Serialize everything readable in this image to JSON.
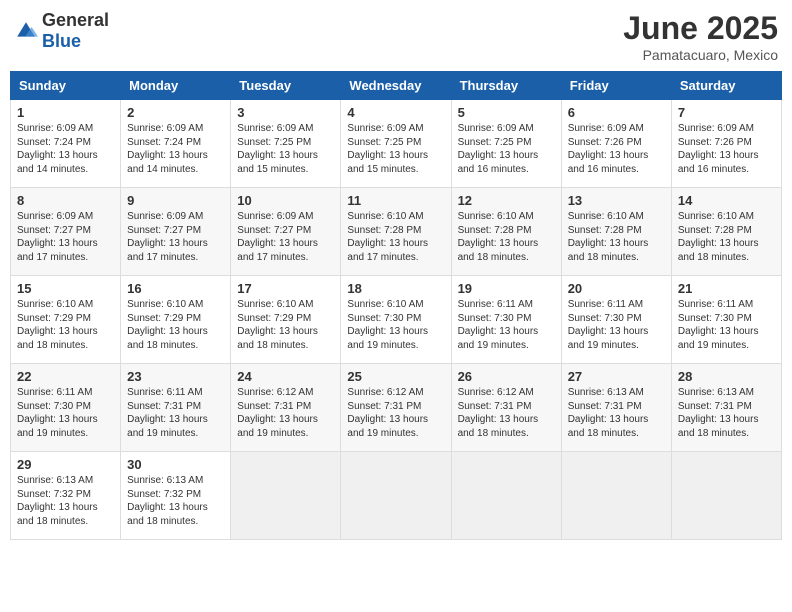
{
  "logo": {
    "general": "General",
    "blue": "Blue"
  },
  "header": {
    "month": "June 2025",
    "location": "Pamatacuaro, Mexico"
  },
  "weekdays": [
    "Sunday",
    "Monday",
    "Tuesday",
    "Wednesday",
    "Thursday",
    "Friday",
    "Saturday"
  ],
  "weeks": [
    [
      {
        "day": 1,
        "sunrise": "6:09 AM",
        "sunset": "7:24 PM",
        "daylight": "13 hours and 14 minutes."
      },
      {
        "day": 2,
        "sunrise": "6:09 AM",
        "sunset": "7:24 PM",
        "daylight": "13 hours and 14 minutes."
      },
      {
        "day": 3,
        "sunrise": "6:09 AM",
        "sunset": "7:25 PM",
        "daylight": "13 hours and 15 minutes."
      },
      {
        "day": 4,
        "sunrise": "6:09 AM",
        "sunset": "7:25 PM",
        "daylight": "13 hours and 15 minutes."
      },
      {
        "day": 5,
        "sunrise": "6:09 AM",
        "sunset": "7:25 PM",
        "daylight": "13 hours and 16 minutes."
      },
      {
        "day": 6,
        "sunrise": "6:09 AM",
        "sunset": "7:26 PM",
        "daylight": "13 hours and 16 minutes."
      },
      {
        "day": 7,
        "sunrise": "6:09 AM",
        "sunset": "7:26 PM",
        "daylight": "13 hours and 16 minutes."
      }
    ],
    [
      {
        "day": 8,
        "sunrise": "6:09 AM",
        "sunset": "7:27 PM",
        "daylight": "13 hours and 17 minutes."
      },
      {
        "day": 9,
        "sunrise": "6:09 AM",
        "sunset": "7:27 PM",
        "daylight": "13 hours and 17 minutes."
      },
      {
        "day": 10,
        "sunrise": "6:09 AM",
        "sunset": "7:27 PM",
        "daylight": "13 hours and 17 minutes."
      },
      {
        "day": 11,
        "sunrise": "6:10 AM",
        "sunset": "7:28 PM",
        "daylight": "13 hours and 17 minutes."
      },
      {
        "day": 12,
        "sunrise": "6:10 AM",
        "sunset": "7:28 PM",
        "daylight": "13 hours and 18 minutes."
      },
      {
        "day": 13,
        "sunrise": "6:10 AM",
        "sunset": "7:28 PM",
        "daylight": "13 hours and 18 minutes."
      },
      {
        "day": 14,
        "sunrise": "6:10 AM",
        "sunset": "7:28 PM",
        "daylight": "13 hours and 18 minutes."
      }
    ],
    [
      {
        "day": 15,
        "sunrise": "6:10 AM",
        "sunset": "7:29 PM",
        "daylight": "13 hours and 18 minutes."
      },
      {
        "day": 16,
        "sunrise": "6:10 AM",
        "sunset": "7:29 PM",
        "daylight": "13 hours and 18 minutes."
      },
      {
        "day": 17,
        "sunrise": "6:10 AM",
        "sunset": "7:29 PM",
        "daylight": "13 hours and 18 minutes."
      },
      {
        "day": 18,
        "sunrise": "6:10 AM",
        "sunset": "7:30 PM",
        "daylight": "13 hours and 19 minutes."
      },
      {
        "day": 19,
        "sunrise": "6:11 AM",
        "sunset": "7:30 PM",
        "daylight": "13 hours and 19 minutes."
      },
      {
        "day": 20,
        "sunrise": "6:11 AM",
        "sunset": "7:30 PM",
        "daylight": "13 hours and 19 minutes."
      },
      {
        "day": 21,
        "sunrise": "6:11 AM",
        "sunset": "7:30 PM",
        "daylight": "13 hours and 19 minutes."
      }
    ],
    [
      {
        "day": 22,
        "sunrise": "6:11 AM",
        "sunset": "7:30 PM",
        "daylight": "13 hours and 19 minutes."
      },
      {
        "day": 23,
        "sunrise": "6:11 AM",
        "sunset": "7:31 PM",
        "daylight": "13 hours and 19 minutes."
      },
      {
        "day": 24,
        "sunrise": "6:12 AM",
        "sunset": "7:31 PM",
        "daylight": "13 hours and 19 minutes."
      },
      {
        "day": 25,
        "sunrise": "6:12 AM",
        "sunset": "7:31 PM",
        "daylight": "13 hours and 19 minutes."
      },
      {
        "day": 26,
        "sunrise": "6:12 AM",
        "sunset": "7:31 PM",
        "daylight": "13 hours and 18 minutes."
      },
      {
        "day": 27,
        "sunrise": "6:13 AM",
        "sunset": "7:31 PM",
        "daylight": "13 hours and 18 minutes."
      },
      {
        "day": 28,
        "sunrise": "6:13 AM",
        "sunset": "7:31 PM",
        "daylight": "13 hours and 18 minutes."
      }
    ],
    [
      {
        "day": 29,
        "sunrise": "6:13 AM",
        "sunset": "7:32 PM",
        "daylight": "13 hours and 18 minutes."
      },
      {
        "day": 30,
        "sunrise": "6:13 AM",
        "sunset": "7:32 PM",
        "daylight": "13 hours and 18 minutes."
      },
      null,
      null,
      null,
      null,
      null
    ]
  ]
}
